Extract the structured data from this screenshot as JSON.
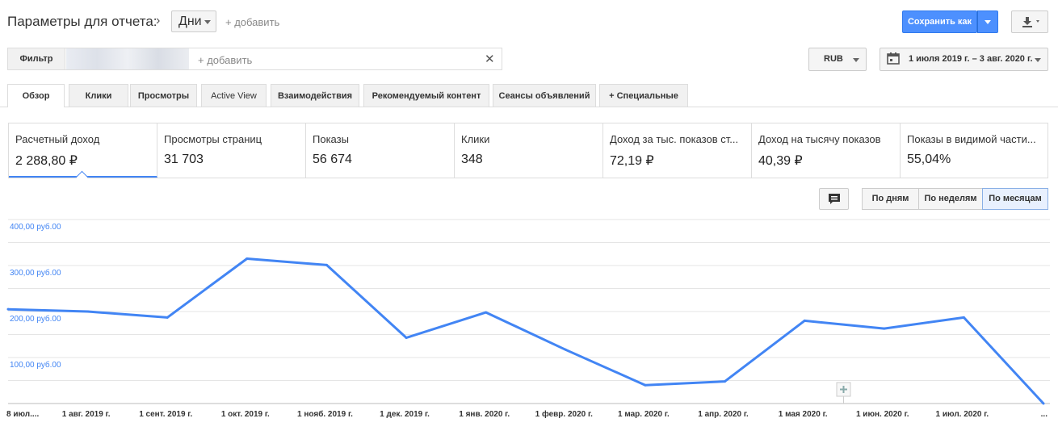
{
  "header": {
    "title": "Параметры для отчета:",
    "granularity": "Дни",
    "add_link": "+ добавить",
    "save_label": "Сохранить как"
  },
  "filter": {
    "label": "Фильтр",
    "add_placeholder": "+ добавить",
    "close": "✕"
  },
  "currency": "RUB",
  "date_range": "1 июля 2019 г. – 3 авг. 2020 г.",
  "tabs": [
    {
      "label": "Обзор"
    },
    {
      "label": "Клики"
    },
    {
      "label": "Просмотры"
    },
    {
      "label": "Active View"
    },
    {
      "label": "Взаимодействия"
    },
    {
      "label": "Рекомендуемый контент"
    },
    {
      "label": "Сеансы объявлений"
    },
    {
      "label": "+  Специальные"
    }
  ],
  "metrics": [
    {
      "label": "Расчетный доход",
      "value": "2 288,80 ₽"
    },
    {
      "label": "Просмотры страниц",
      "value": "31 703"
    },
    {
      "label": "Показы",
      "value": "56 674"
    },
    {
      "label": "Клики",
      "value": "348"
    },
    {
      "label": "Доход за тыс. показов ст...",
      "value": "72,19 ₽"
    },
    {
      "label": "Доход на тысячу показов",
      "value": "40,39 ₽"
    },
    {
      "label": "Показы в видимой части...",
      "value": "55,04%"
    }
  ],
  "granularity_buttons": {
    "day": "По дням",
    "week": "По неделям",
    "month": "По месяцам"
  },
  "chart_data": {
    "type": "line",
    "y_tick_labels": [
      "400,00 руб.00",
      "300,00 руб.00",
      "200,00 руб.00",
      "100,00 руб.00"
    ],
    "y_ticks": [
      400,
      300,
      200,
      100
    ],
    "ylim": [
      0,
      400
    ],
    "grid": true,
    "x_tick_labels": [
      "8 июл....",
      "1 авг. 2019 г.",
      "1 сент. 2019 г.",
      "1 окт. 2019 г.",
      "1 нояб. 2019 г.",
      "1 дек. 2019 г.",
      "1 янв. 2020 г.",
      "1 февр. 2020 г.",
      "1 мар. 2020 г.",
      "1 апр. 2020 г.",
      "1 мая 2020 г.",
      "1 июн. 2020 г.",
      "1 июл. 2020 г.",
      "..."
    ],
    "series": [
      {
        "color": "#4285f4",
        "values": [
          205,
          200,
          187,
          315,
          301,
          143,
          198,
          117,
          40,
          48,
          180,
          163,
          187,
          0
        ]
      }
    ]
  },
  "colors": {
    "accent": "#4285f4",
    "save_button": "#4d90fe"
  }
}
